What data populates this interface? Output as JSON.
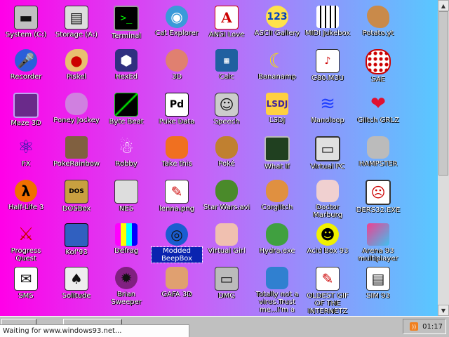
{
  "desktop": {
    "icons": [
      {
        "label": "System (C:)",
        "icon": "hard-drive-icon",
        "glyph": "▬",
        "style": "g-sys"
      },
      {
        "label": "Storage (A:)",
        "icon": "floppy-disk-icon",
        "glyph": "▤",
        "style": "g-disk"
      },
      {
        "label": "Terminal",
        "icon": "terminal-icon",
        "glyph": ">_",
        "style": "g-term"
      },
      {
        "label": "Cat Explorer",
        "icon": "globe-icon",
        "glyph": "◉",
        "style": "g-cat"
      },
      {
        "label": "ANSI Love",
        "icon": "ansi-icon",
        "glyph": "A",
        "style": "g-ansi"
      },
      {
        "label": "ASCII Gallery",
        "icon": "ascii-gallery-icon",
        "glyph": "123",
        "style": "g-ascii"
      },
      {
        "label": "MIDI Jukebox",
        "icon": "piano-keys-icon",
        "glyph": "",
        "style": "g-midi"
      },
      {
        "label": "Potato.yt",
        "icon": "potato-icon",
        "glyph": "",
        "style": "g-potato"
      },
      {
        "label": "Recorder",
        "icon": "microphone-icon",
        "glyph": "🎤",
        "style": "g-mic"
      },
      {
        "label": "Piskel",
        "icon": "palette-icon",
        "glyph": "●",
        "style": "g-palette"
      },
      {
        "label": "HexEd",
        "icon": "hex-cube-icon",
        "glyph": "⬢",
        "style": "g-hex"
      },
      {
        "label": "3D",
        "icon": "teapot-icon",
        "glyph": "",
        "style": "g-3d"
      },
      {
        "label": "Calc",
        "icon": "calculator-icon",
        "glyph": "▦",
        "style": "g-calc"
      },
      {
        "label": "Bananamp",
        "icon": "banana-icon",
        "glyph": "☾",
        "style": "g-banana"
      },
      {
        "label": "G80.M3U",
        "icon": "playlist-file-icon",
        "glyph": "♪",
        "style": "g-m3u"
      },
      {
        "label": "SAE",
        "icon": "amiga-ball-icon",
        "glyph": "",
        "style": "g-sae"
      },
      {
        "label": "Maze 3D",
        "icon": "maze-icon",
        "glyph": "",
        "style": "g-maze"
      },
      {
        "label": "Poney Jockey",
        "icon": "pony-icon",
        "glyph": "",
        "style": "g-pony"
      },
      {
        "label": "Byte Beat",
        "icon": "byte-beat-icon",
        "glyph": "",
        "style": "g-byte"
      },
      {
        "label": "Puke Data",
        "icon": "pd-document-icon",
        "glyph": "Pd",
        "style": "g-puke"
      },
      {
        "label": "Speech",
        "icon": "speech-face-icon",
        "glyph": "☺",
        "style": "g-speech"
      },
      {
        "label": "LSDJ",
        "icon": "lsdj-icon",
        "glyph": "LSDJ",
        "style": "g-lsdj"
      },
      {
        "label": "Nanoloop",
        "icon": "nanoloop-icon",
        "glyph": "≋",
        "style": "g-nano"
      },
      {
        "label": "Glitch GRLZ",
        "icon": "lips-icon",
        "glyph": "❤",
        "style": "g-glitch"
      },
      {
        "label": "FX",
        "icon": "atom-icon",
        "glyph": "⚛",
        "style": "g-fx"
      },
      {
        "label": "PokeRainbow",
        "icon": "pokerainbow-icon",
        "glyph": "",
        "style": "g-poke"
      },
      {
        "label": "Robby",
        "icon": "stick-figure-icon",
        "glyph": "☃",
        "style": "g-robby"
      },
      {
        "label": "Take this",
        "icon": "pixel-man-icon",
        "glyph": "",
        "style": "g-takethis"
      },
      {
        "label": "Poké",
        "icon": "poke-icon",
        "glyph": "",
        "style": "g-pokex"
      },
      {
        "label": "What If",
        "icon": "what-if-icon",
        "glyph": "",
        "style": "g-whatif"
      },
      {
        "label": "Virtual PC",
        "icon": "virtual-pc-icon",
        "glyph": "▭",
        "style": "g-vpc"
      },
      {
        "label": "HAMPSTER",
        "icon": "hamster-icon",
        "glyph": "",
        "style": "g-hampster"
      },
      {
        "label": "Half-Life 3",
        "icon": "lambda-icon",
        "glyph": "λ",
        "style": "g-hl"
      },
      {
        "label": "DOSBox",
        "icon": "dosbox-icon",
        "glyph": "DOS",
        "style": "g-dosbox"
      },
      {
        "label": "NES",
        "icon": "nes-console-icon",
        "glyph": "",
        "style": "g-nes"
      },
      {
        "label": "lenna.png",
        "icon": "image-file-icon",
        "glyph": "✎",
        "style": "g-lenna"
      },
      {
        "label": "Star Wars.avi",
        "icon": "yoda-icon",
        "glyph": "",
        "style": "g-star"
      },
      {
        "label": "Corglitch",
        "icon": "corgi-icon",
        "glyph": "",
        "style": "g-corg"
      },
      {
        "label": "Doctor Marburg",
        "icon": "doctor-icon",
        "glyph": "",
        "style": "g-doc"
      },
      {
        "label": "DERS32.EXE",
        "icon": "terminal-face-icon",
        "glyph": "☹",
        "style": "g-der"
      },
      {
        "label": "Progress Quest",
        "icon": "crossed-swords-icon",
        "glyph": "⚔",
        "style": "g-quest"
      },
      {
        "label": "Kof'93",
        "icon": "fighter-icon",
        "glyph": "",
        "style": "g-kof"
      },
      {
        "label": "Defrag",
        "icon": "defrag-icon",
        "glyph": "",
        "style": "g-defrag"
      },
      {
        "label": "Modded BeepBox",
        "icon": "beepbox-icon",
        "glyph": "◎",
        "style": "g-beep"
      },
      {
        "label": "Virtual Girl",
        "icon": "girl-face-icon",
        "glyph": "",
        "style": "g-vgirl"
      },
      {
        "label": "Hydra.exe",
        "icon": "hydra-icon",
        "glyph": "",
        "style": "g-hydra"
      },
      {
        "label": "Acid Box 93",
        "icon": "smiley-icon",
        "glyph": "☻",
        "style": "g-acid"
      },
      {
        "label": "Arena 93 multiplayer",
        "icon": "cube-icon",
        "glyph": "",
        "style": "g-arena"
      },
      {
        "label": "SMS",
        "icon": "sms-icon",
        "glyph": "✉",
        "style": "g-sms"
      },
      {
        "label": "Solitude",
        "icon": "cards-icon",
        "glyph": "♠",
        "style": "g-solitude"
      },
      {
        "label": "Brian Sweeper",
        "icon": "mine-icon",
        "glyph": "✹",
        "style": "g-brian"
      },
      {
        "label": "GAFA 3D",
        "icon": "face-icon",
        "glyph": "",
        "style": "g-gafa"
      },
      {
        "label": "DMG",
        "icon": "gameboy-icon",
        "glyph": "▭",
        "style": "g-dmg"
      },
      {
        "label": "Totally not a virus.Trust me...I'm a",
        "icon": "dolphin-icon",
        "glyph": "",
        "style": "g-dolphin"
      },
      {
        "label": "OLDEST GIF OF THE INTERNETZ",
        "icon": "gif-file-icon",
        "glyph": "✎",
        "style": "g-gif"
      },
      {
        "label": "SIM 93",
        "icon": "sim-book-icon",
        "glyph": "▤",
        "style": "g-sim"
      }
    ]
  },
  "statusbar": {
    "text": "Waiting for www.windows93.net..."
  },
  "tray": {
    "clock": "01:17",
    "rss_glyph": "))"
  },
  "scrollbar": {
    "up": "▲",
    "down": "▼"
  }
}
